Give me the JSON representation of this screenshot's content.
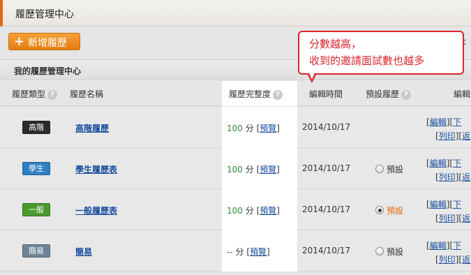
{
  "header": {
    "title": "履歷管理中心"
  },
  "toolbar": {
    "add_label": "新增履歷",
    "add_icon": "plus-icon",
    "overflow_text": ":"
  },
  "section": {
    "title": "我的履歷管理中心"
  },
  "columns": {
    "type": "履歷類型",
    "name": "履歷名稱",
    "completeness": "履歷完整度",
    "edit_time": "編輯時間",
    "default": "預設履歷",
    "actions": "編輯"
  },
  "rows": [
    {
      "badge": "高階",
      "badge_color": "#2b2b2b",
      "name": "高階履歷",
      "score": "100",
      "unit": "分",
      "preview": "預覽",
      "date": "2014/10/17",
      "has_default": false,
      "default_selected": false,
      "default_label": "",
      "actions_line1": [
        "編輯",
        "下"
      ],
      "actions_line2": [
        "列印",
        "返"
      ]
    },
    {
      "badge": "學生",
      "badge_color": "#2e7fc1",
      "name": "學生履歷表",
      "score": "100",
      "unit": "分",
      "preview": "預覽",
      "date": "2014/10/17",
      "has_default": true,
      "default_selected": false,
      "default_label": "預設",
      "actions_line1": [
        "編輯",
        "下"
      ],
      "actions_line2": [
        "列印",
        "返"
      ]
    },
    {
      "badge": "一般",
      "badge_color": "#4a9a2e",
      "name": "一般履歷表",
      "score": "100",
      "unit": "分",
      "preview": "預覽",
      "date": "2014/10/17",
      "has_default": true,
      "default_selected": true,
      "default_label": "預設",
      "actions_line1": [
        "編輯",
        "下"
      ],
      "actions_line2": [
        "列印",
        "返"
      ]
    },
    {
      "badge": "簡易",
      "badge_color": "#6e8597",
      "name": "簡易",
      "score": "--",
      "unit": "分",
      "preview": "預覽",
      "date": "2014/10/17",
      "has_default": true,
      "default_selected": false,
      "default_label": "預設",
      "actions_line1": [
        "編輯",
        "下"
      ],
      "actions_line2": [
        "列印",
        "返"
      ]
    }
  ],
  "callout": {
    "line1": "分數越高，",
    "line2": "收到的邀請面試數也越多"
  },
  "colors": {
    "accent": "#e36b0e",
    "link": "#1a4fa0",
    "callout": "#d9262c",
    "score": "#2d8a3a"
  }
}
